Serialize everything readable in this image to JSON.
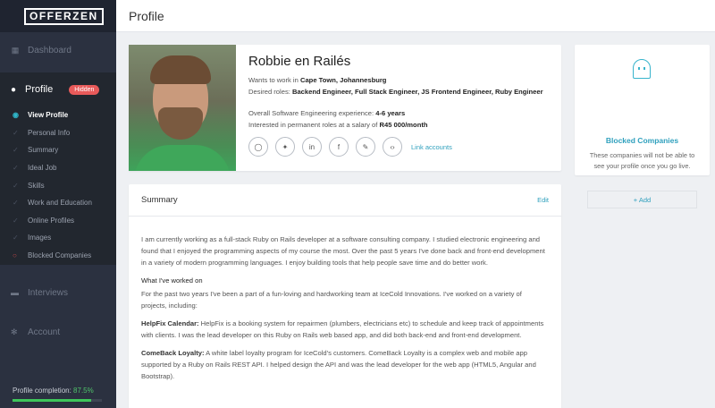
{
  "brand": {
    "logo_text": "OFFERZEN"
  },
  "sidebar": {
    "dashboard": "Dashboard",
    "profile": "Profile",
    "hidden_badge": "Hidden",
    "items": [
      "View Profile",
      "Personal Info",
      "Summary",
      "Ideal Job",
      "Skills",
      "Work and Education",
      "Online Profiles",
      "Images",
      "Blocked Companies"
    ],
    "interviews": "Interviews",
    "account": "Account",
    "completion_label": "Profile completion:",
    "completion_value": "87.5%",
    "completion_fraction": 0.875
  },
  "header": {
    "title": "Profile"
  },
  "profile": {
    "name": "Robbie en Railés",
    "wants_prefix": "Wants to work in ",
    "locations": "Cape Town, Johannesburg",
    "roles_prefix": "Desired roles: ",
    "roles": "Backend Engineer, Full Stack Engineer, JS Frontend Engineer, Ruby Engineer",
    "exp_prefix": "Overall Software Engineering experience: ",
    "experience": "4-6 years",
    "salary_prefix": "Interested in permanent roles at a salary of ",
    "salary": "R45 000/month",
    "link_accounts": "Link accounts",
    "social_glyphs": [
      "◯",
      "✦",
      "in",
      "f",
      "✎",
      "‹›"
    ]
  },
  "blocked": {
    "title": "Blocked Companies",
    "desc": "These companies will not be able to see your profile once you go live.",
    "add": "+ Add"
  },
  "summary": {
    "title": "Summary",
    "edit": "Edit",
    "intro": "I am currently working as a full-stack Ruby on Rails developer at a software consulting company. I studied electronic engineering and found that I enjoyed the programming aspects of my course the most. Over the past 5 years I've done back and front-end development in a variety of modern programming languages. I enjoy building tools that help people save time and do better work.",
    "worked_heading": "What I've worked on",
    "worked_intro": "For the past two years I've been a part of a fun-loving and hardworking team at IceCold Innovations. I've worked on a variety of projects, including:",
    "p1_name": "HelpFix Calendar:",
    "p1_text": " HelpFix is a booking system for repairmen (plumbers, electricians etc) to schedule and keep track of appointments with clients. I was the lead developer on this Ruby on Rails web based app, and did both back-end and front-end development.",
    "p2_name": "ComeBack Loyalty:",
    "p2_text": " A white label loyalty program for IceCold's customers. ComeBack Loyalty is a complex web and mobile app supported by a Ruby on Rails REST API. I helped design the API and was the lead developer for the web app (HTML5, Angular and Bootstrap)."
  },
  "colors": {
    "accent": "#2fa0bd",
    "sidebar": "#2b3140",
    "badge": "#e85a5a",
    "progress": "#3ec65a"
  }
}
